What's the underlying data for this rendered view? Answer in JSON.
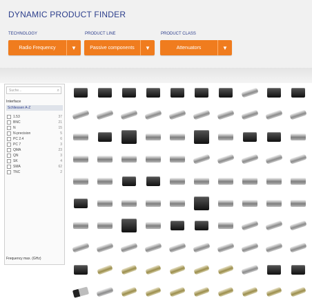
{
  "header": {
    "title": "DYNAMIC PRODUCT FINDER",
    "filters": [
      {
        "label": "TECHNOLOGY",
        "value": "Radio Frequency"
      },
      {
        "label": "PRODUCT LINE",
        "value": "Passive components"
      },
      {
        "label": "PRODUCT CLASS",
        "value": "Attenuators"
      }
    ]
  },
  "sidebar": {
    "search_placeholder": "Suche...",
    "section": "Interface",
    "selected": "Schliessen A-Z",
    "options": [
      {
        "label": "1.53",
        "count": "37"
      },
      {
        "label": "BNC",
        "count": "21"
      },
      {
        "label": "N",
        "count": "15"
      },
      {
        "label": "N-precision",
        "count": "5"
      },
      {
        "label": "PC 2.4",
        "count": "6"
      },
      {
        "label": "PC 7",
        "count": "3"
      },
      {
        "label": "QMA",
        "count": "23"
      },
      {
        "label": "QN",
        "count": "3"
      },
      {
        "label": "SK",
        "count": "4"
      },
      {
        "label": "SMA",
        "count": "62"
      },
      {
        "label": "TNC",
        "count": "2"
      }
    ],
    "footer": "Frequency max. (GHz)"
  },
  "product_grid": {
    "rows": [
      [
        "box",
        "box",
        "box",
        "box",
        "box",
        "box",
        "box",
        "barrel",
        "box",
        "box"
      ],
      [
        "barrel",
        "barrel",
        "barrel",
        "barrel",
        "barrel",
        "barrel",
        "barrel",
        "barrel",
        "barrel",
        "barrel"
      ],
      [
        "adapt",
        "box",
        "box-big",
        "adapt",
        "adapt",
        "box-big",
        "adapt",
        "box",
        "box",
        "adapt"
      ],
      [
        "adapt",
        "adapt",
        "adapt",
        "adapt",
        "adapt",
        "barrel",
        "barrel",
        "barrel",
        "barrel",
        "barrel"
      ],
      [
        "adapt",
        "adapt",
        "box",
        "box",
        "adapt",
        "adapt",
        "adapt",
        "adapt",
        "adapt",
        "adapt"
      ],
      [
        "box",
        "adapt",
        "adapt",
        "adapt",
        "adapt",
        "box-big",
        "adapt",
        "adapt",
        "adapt",
        "adapt"
      ],
      [
        "adapt",
        "adapt",
        "box-big",
        "adapt",
        "box",
        "box",
        "adapt",
        "barrel",
        "barrel",
        "barrel"
      ],
      [
        "barrel",
        "barrel",
        "barrel",
        "barrel",
        "barrel",
        "barrel",
        "barrel",
        "barrel",
        "barrel",
        "barrel"
      ],
      [
        "box",
        "gold",
        "gold",
        "gold",
        "gold",
        "gold",
        "gold",
        "barrel",
        "box",
        "box"
      ],
      [
        "mix",
        "barrel",
        "gold",
        "gold",
        "gold",
        "gold",
        "gold",
        "gold",
        "gold",
        "gold"
      ]
    ]
  }
}
